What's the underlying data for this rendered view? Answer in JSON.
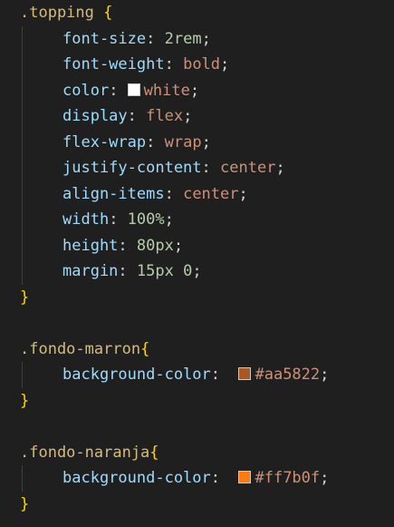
{
  "blocks": [
    {
      "selector": ".topping",
      "open": " {",
      "close": "}",
      "declarations": [
        {
          "property": "font-size",
          "value": "2rem",
          "kind": "num"
        },
        {
          "property": "font-weight",
          "value": "bold",
          "kind": "val"
        },
        {
          "property": "color",
          "value": "white",
          "kind": "val",
          "swatch": "#ffffff"
        },
        {
          "property": "display",
          "value": "flex",
          "kind": "val"
        },
        {
          "property": "flex-wrap",
          "value": "wrap",
          "kind": "val"
        },
        {
          "property": "justify-content",
          "value": "center",
          "kind": "val"
        },
        {
          "property": "align-items",
          "value": "center",
          "kind": "val"
        },
        {
          "property": "width",
          "value": "100%",
          "kind": "num"
        },
        {
          "property": "height",
          "value": "80px",
          "kind": "num"
        },
        {
          "property": "margin",
          "value": "15px 0",
          "kind": "num"
        }
      ]
    },
    {
      "selector": ".fondo-marron",
      "open": "{",
      "close": "}",
      "declarations": [
        {
          "property": "background-color",
          "value": "#aa5822",
          "kind": "val",
          "swatch": "#aa5822"
        }
      ]
    },
    {
      "selector": ".fondo-naranja",
      "open": "{",
      "close": "}",
      "declarations": [
        {
          "property": "background-color",
          "value": "#ff7b0f",
          "kind": "val",
          "swatch": "#ff7b0f"
        }
      ]
    }
  ],
  "theme": {
    "background": "#1f1f1f",
    "selector_color": "#d7ba7d",
    "brace_color": "#ffd700",
    "property_color": "#9cdcfe",
    "value_color": "#ce9178",
    "number_color": "#b5cea8"
  }
}
